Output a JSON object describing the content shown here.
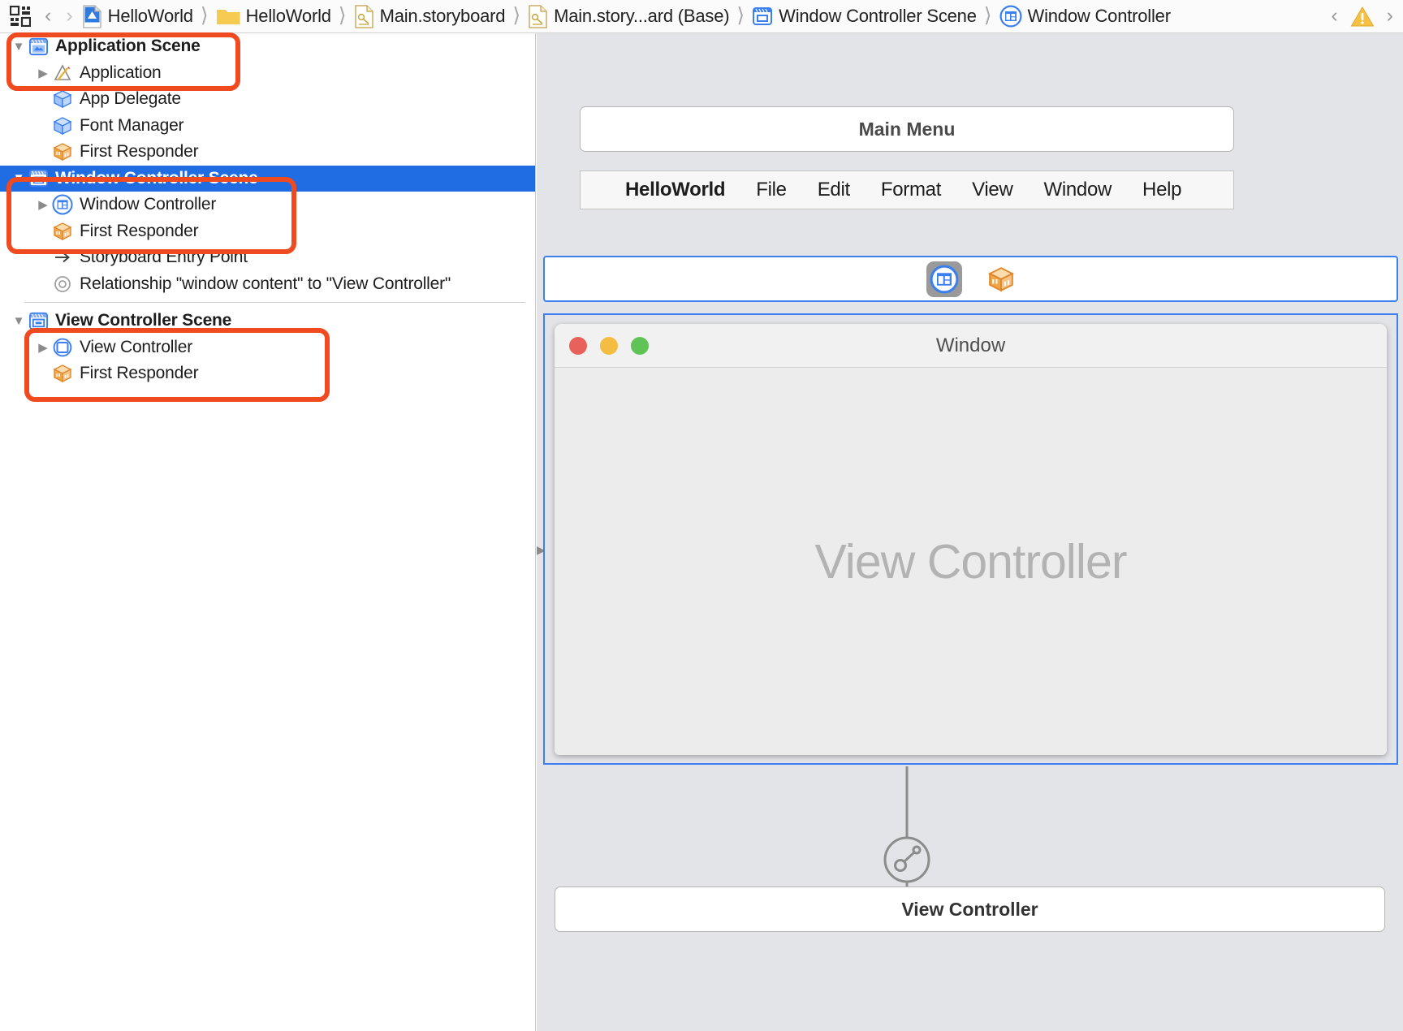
{
  "breadcrumb": {
    "items": [
      {
        "label": "HelloWorld",
        "icon": "xcode-project-icon"
      },
      {
        "label": "HelloWorld",
        "icon": "folder-icon"
      },
      {
        "label": "Main.storyboard",
        "icon": "storyboard-file-icon"
      },
      {
        "label": "Main.story...ard (Base)",
        "icon": "storyboard-file-icon"
      },
      {
        "label": "Window Controller Scene",
        "icon": "scene-icon"
      },
      {
        "label": "Window Controller",
        "icon": "window-controller-icon"
      }
    ],
    "back_arrow": "‹",
    "forward_arrow": "›",
    "issue_prev": "‹",
    "issue_next": "›",
    "warning_icon": "warning-triangle-icon"
  },
  "outline": {
    "rows": [
      {
        "label": "Application Scene",
        "indent": 0,
        "twisty": "down",
        "icon": "scene-icon",
        "bold": true,
        "selected": false
      },
      {
        "label": "Application",
        "indent": 1,
        "twisty": "right",
        "icon": "application-icon",
        "bold": false,
        "selected": false
      },
      {
        "label": "App Delegate",
        "indent": 1,
        "twisty": "none",
        "icon": "object-cube-blue-icon",
        "bold": false,
        "selected": false
      },
      {
        "label": "Font Manager",
        "indent": 1,
        "twisty": "none",
        "icon": "object-cube-blue-icon",
        "bold": false,
        "selected": false
      },
      {
        "label": "First Responder",
        "indent": 1,
        "twisty": "none",
        "icon": "first-responder-icon",
        "bold": false,
        "selected": false
      },
      {
        "label": "Window Controller Scene",
        "indent": 0,
        "twisty": "down",
        "icon": "scene-icon",
        "bold": true,
        "selected": true
      },
      {
        "label": "Window Controller",
        "indent": 1,
        "twisty": "right",
        "icon": "window-controller-icon",
        "bold": false,
        "selected": false
      },
      {
        "label": "First Responder",
        "indent": 1,
        "twisty": "none",
        "icon": "first-responder-icon",
        "bold": false,
        "selected": false
      },
      {
        "label": "Storyboard Entry Point",
        "indent": 1,
        "twisty": "none",
        "icon": "entry-point-arrow-icon",
        "bold": false,
        "selected": false
      },
      {
        "label": "Relationship \"window content\" to \"View Controller\"",
        "indent": 1,
        "twisty": "none",
        "icon": "segue-relationship-icon",
        "bold": false,
        "selected": false
      },
      {
        "label": "View Controller Scene",
        "indent": 0,
        "twisty": "down",
        "icon": "scene-icon",
        "bold": true,
        "selected": false
      },
      {
        "label": "View Controller",
        "indent": 1,
        "twisty": "right",
        "icon": "view-controller-icon",
        "bold": false,
        "selected": false
      },
      {
        "label": "First Responder",
        "indent": 1,
        "twisty": "none",
        "icon": "first-responder-icon",
        "bold": false,
        "selected": false
      }
    ]
  },
  "canvas": {
    "main_menu_title": "Main Menu",
    "menu_items": [
      "HelloWorld",
      "File",
      "Edit",
      "Format",
      "View",
      "Window",
      "Help"
    ],
    "window_controller_toolbar": {
      "selected_icon": "window-controller-icon",
      "other_icon": "first-responder-icon"
    },
    "window": {
      "title": "Window",
      "watermark": "View Controller",
      "traffic_lights": [
        "close",
        "minimize",
        "zoom"
      ]
    },
    "view_controller_label": "View Controller"
  },
  "colors": {
    "selection_blue": "#206ce3",
    "annotation_orange": "#f04a21",
    "canvas_bg": "#e2e4e8",
    "focus_border": "#3b7ff0"
  }
}
